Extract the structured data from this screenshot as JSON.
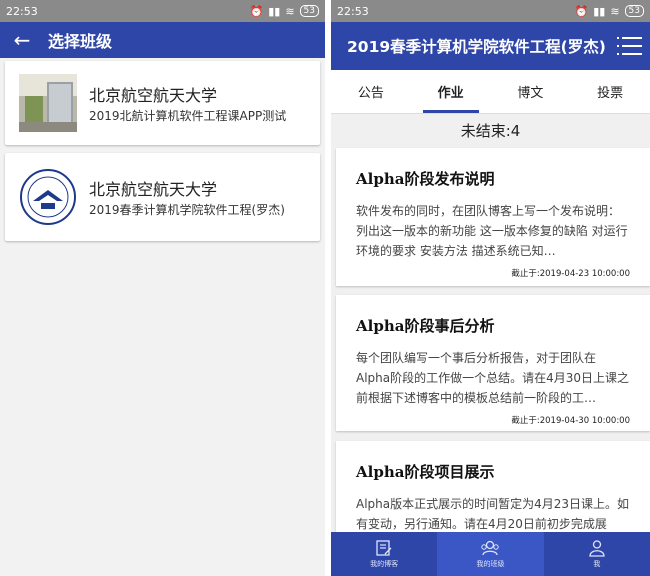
{
  "left": {
    "status": {
      "time": "22:53",
      "battery": "53"
    },
    "header": {
      "title": "选择班级"
    },
    "classes": [
      {
        "university": "北京航空航天大学",
        "course": "2019北航计算机软件工程课APP测试"
      },
      {
        "university": "北京航空航天大学",
        "course": "2019春季计算机学院软件工程(罗杰)"
      }
    ]
  },
  "right": {
    "status": {
      "time": "22:53",
      "battery": "53"
    },
    "header": {
      "title": "2019春季计算机学院软件工程(罗杰)"
    },
    "tabs": [
      "公告",
      "作业",
      "博文",
      "投票"
    ],
    "active_tab": 1,
    "unfinished": "未结束:4",
    "tasks": [
      {
        "title": "Alpha阶段发布说明",
        "desc": "软件发布的同时，在团队博客上写一个发布说明：列出这一版本的新功能 这一版本修复的缺陷 对运行环境的要求 安装方法 描述系统已知…",
        "due": "截止于:2019-04-23 10:00:00"
      },
      {
        "title": "Alpha阶段事后分析",
        "desc": "每个团队编写一个事后分析报告，对于团队在Alpha阶段的工作做一个总结。请在4月30日上课之前根据下述博客中的模板总结前一阶段的工…",
        "due": "截止于:2019-04-30 10:00:00"
      },
      {
        "title": "Alpha阶段项目展示",
        "desc": "Alpha版本正式展示的时间暂定为4月23日课上。如有变动，另行通知。请在4月20日前初步完成展",
        "due": ""
      }
    ],
    "bottom_nav": [
      "我的博客",
      "我的班级",
      "我"
    ],
    "colors": {
      "primary": "#2f46a9",
      "nav_active": "#3b57c6"
    }
  }
}
